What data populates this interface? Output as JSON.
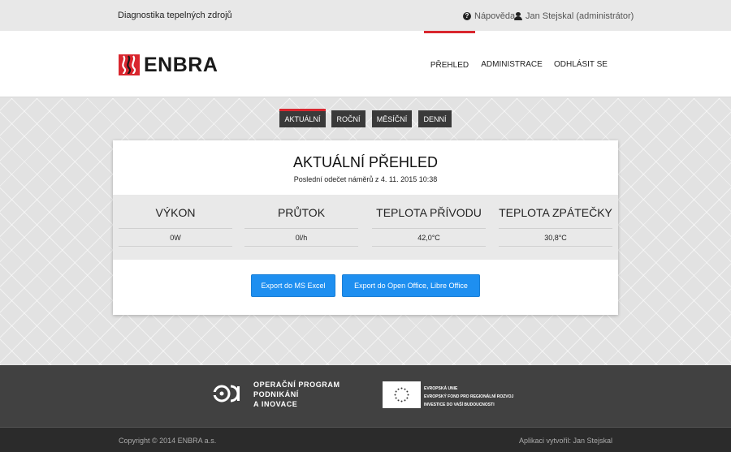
{
  "topbar": {
    "site_name": "Diagnostika tepelných zdrojů",
    "help_label": "Nápověda",
    "user_label": "Jan Stejskal (administrátor)"
  },
  "header": {
    "logo_text": "ENBRA",
    "nav": [
      {
        "label": "PŘEHLED",
        "active": true
      },
      {
        "label": "ADMINISTRACE",
        "active": false
      },
      {
        "label": "ODHLÁSIT SE",
        "active": false
      }
    ]
  },
  "tabs": [
    {
      "label": "AKTUÁLNÍ",
      "active": true
    },
    {
      "label": "ROČNÍ",
      "active": false
    },
    {
      "label": "MĚSÍČNÍ",
      "active": false
    },
    {
      "label": "DENNÍ",
      "active": false
    }
  ],
  "card": {
    "title": "AKTUÁLNÍ PŘEHLED",
    "subtitle": "Poslední odečet náměrů z 4. 11. 2015 10:38",
    "metrics": [
      {
        "label": "VÝKON",
        "value": "0W"
      },
      {
        "label": "PRŮTOK",
        "value": "0l/h"
      },
      {
        "label": "TEPLOTA PŘÍVODU",
        "value": "42,0°C"
      },
      {
        "label": "TEPLOTA ZPÁTEČKY",
        "value": "30,8°C"
      }
    ],
    "buttons": {
      "excel": "Export do MS Excel",
      "office": "Export do Open Office, Libre Office"
    }
  },
  "footer": {
    "op_lines": [
      "OPERAČNÍ PROGRAM",
      "PODNIKÁNÍ",
      "A INOVACE"
    ],
    "eu_lines": [
      "EVROPSKÁ UNIE",
      "EVROPSKÝ FOND PRO REGIONÁLNÍ ROZVOJ",
      "INVESTICE DO VAŠÍ BUDOUCNOSTI"
    ],
    "copyright": "Copyright © 2014 ENBRA a.s.",
    "author": "Aplikaci vytvořil: Jan Stejskal"
  },
  "colors": {
    "accent_red": "#d9262e",
    "button_blue": "#1e8ff0",
    "tab_dark": "#3a3a3a",
    "footer_dark": "#414141"
  },
  "icons": [
    "help-icon",
    "user-icon",
    "enbra-logo-mark",
    "op-logo",
    "eu-flag-icon"
  ]
}
